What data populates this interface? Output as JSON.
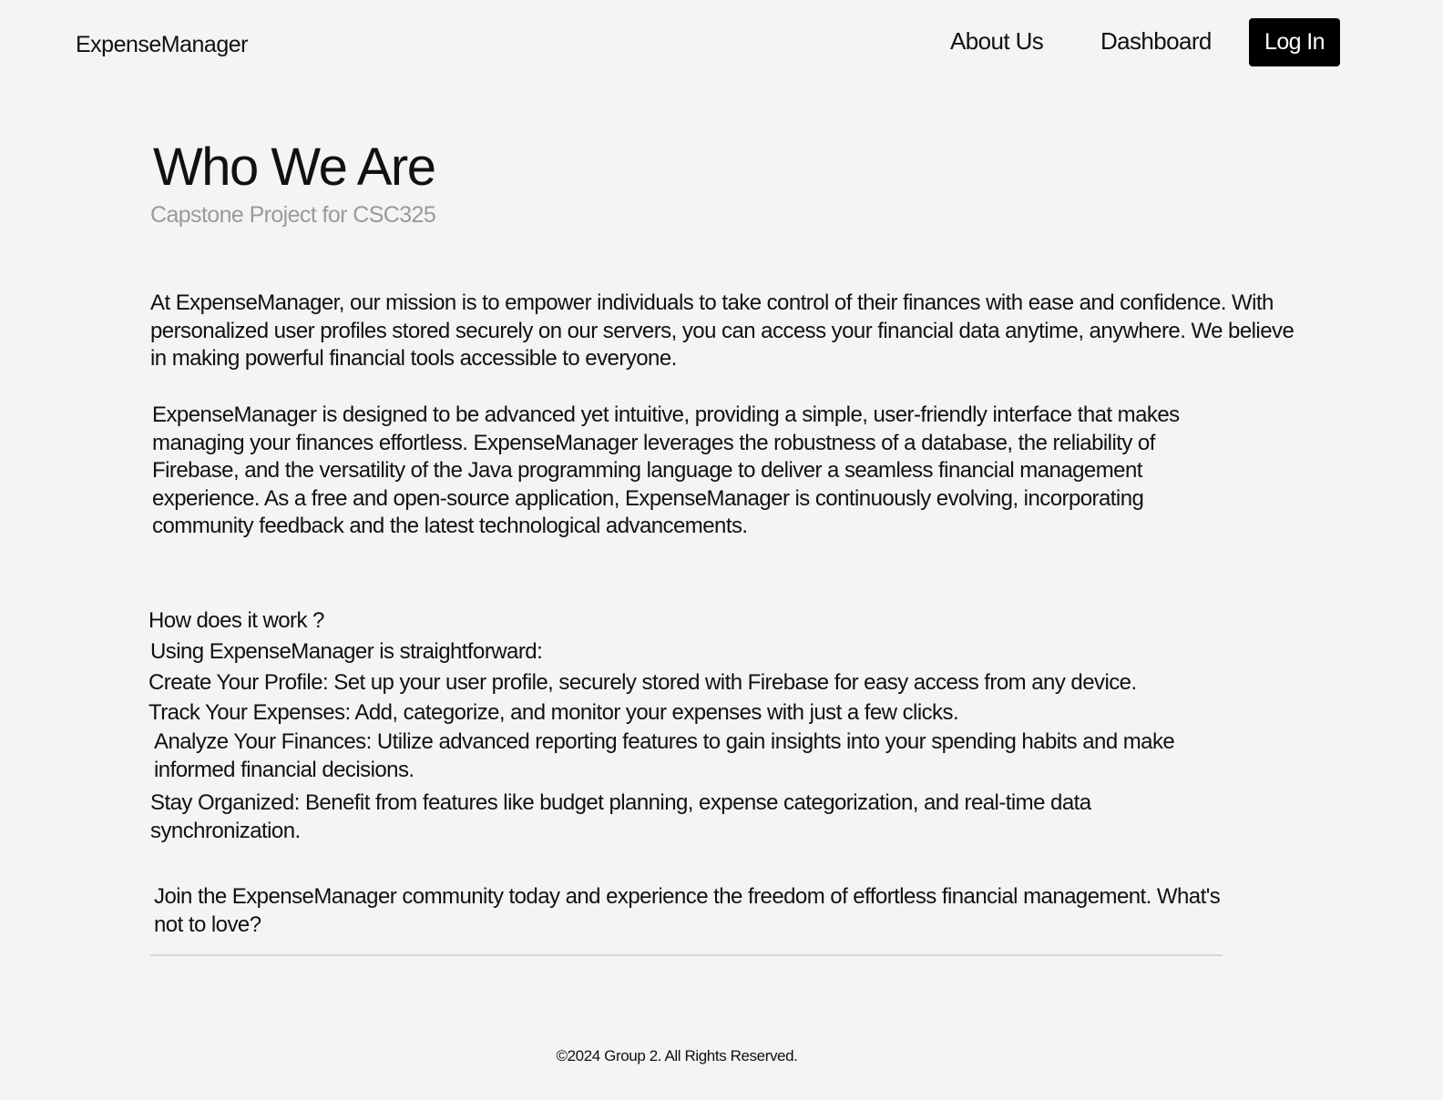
{
  "nav": {
    "brand": "ExpenseManager",
    "links": [
      "About Us",
      "Dashboard"
    ],
    "login_label": "Log In"
  },
  "hero": {
    "title": "Who We Are",
    "subtitle": "Capstone Project for CSC325"
  },
  "content": {
    "mission": "At ExpenseManager, our mission is to empower individuals to take control of their finances with ease and confidence. With personalized user profiles stored securely on our servers, you can access your financial data anytime, anywhere. We believe in making powerful financial tools accessible to everyone.",
    "design": "ExpenseManager is designed to be advanced yet intuitive, providing a simple, user-friendly interface that makes managing your finances effortless. ExpenseManager leverages the robustness of a database, the reliability of Firebase, and the versatility of the Java programming language to deliver a seamless financial management experience. As a free and open-source application, ExpenseManager is continuously evolving, incorporating community feedback and the latest technological advancements.",
    "how_heading": "How does it work ?",
    "how_intro": "Using ExpenseManager is straightforward:",
    "steps": [
      "Create Your Profile: Set up your user profile, securely stored with Firebase for easy access from any device.",
      "Track Your Expenses: Add, categorize, and monitor your expenses with just a few clicks.",
      "Analyze Your Finances: Utilize advanced reporting features to gain insights into your spending habits and make informed financial decisions.",
      "Stay Organized: Benefit from features like budget planning, expense categorization, and real-time data synchronization."
    ],
    "closing": "Join the ExpenseManager community today and experience the freedom of effortless financial management. What's not to love?"
  },
  "footer": {
    "text": "©2024 Group 2. All Rights Reserved."
  }
}
